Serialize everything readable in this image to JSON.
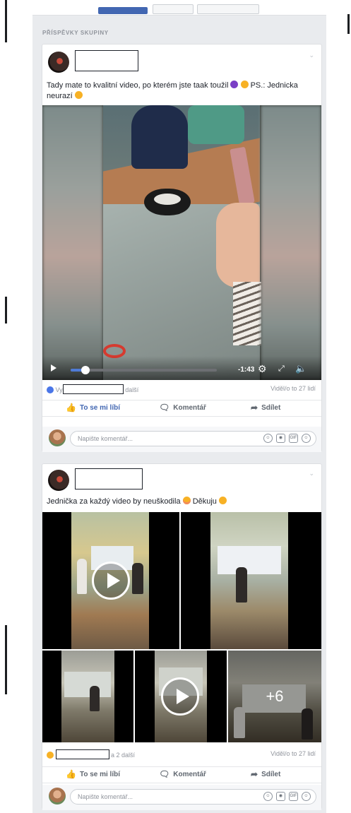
{
  "section_title": "PŘÍSPĚVKY SKUPINY",
  "post1": {
    "text_before": "Tady mate to kvalitní video, po kterém jste taak toužil",
    "text_after": "PS.: Jednicka neurazí",
    "video": {
      "time_left": "-1:43",
      "progress_fraction": 0.1
    },
    "reactions_prefix": "Vy",
    "reactions_suffix": "další",
    "seen": "Viděl/o to 27 lidí"
  },
  "post2": {
    "text_before": "Jednička za každý video by neuškodila",
    "text_after": "Děkuju",
    "more_count": "+6",
    "reactions_suffix": "a 2 další",
    "seen": "Viděl/o to 27 lidí"
  },
  "actions": {
    "like": "To se mi líbí",
    "comment": "Komentář",
    "share": "Sdílet"
  },
  "comment_placeholder": "Napište komentář...",
  "icons": {
    "like": "thumbs-up-icon",
    "comment": "speech-bubble-icon",
    "share": "share-arrow-icon",
    "emoji": "smiley-icon",
    "camera": "camera-icon",
    "gif": "gif-icon",
    "sticker": "sticker-icon"
  },
  "colors": {
    "accent": "#4267b2",
    "feed_bg": "#e9ebee"
  }
}
